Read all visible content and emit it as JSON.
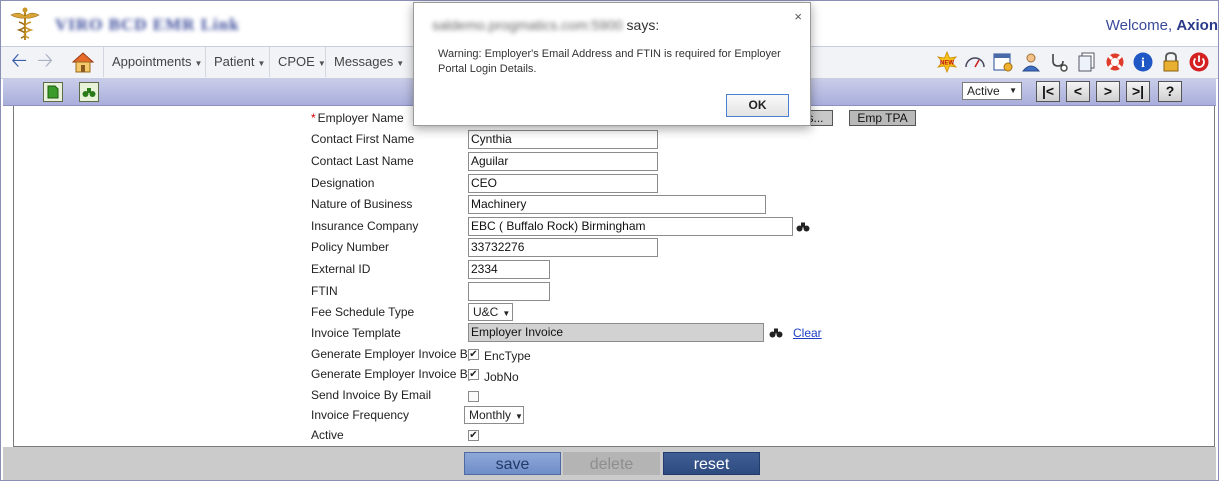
{
  "header": {
    "app_title": "VIRO BCD EMR Link",
    "welcome_text": "Welcome,",
    "user_name": "Axion"
  },
  "nav": {
    "menus": [
      {
        "label": "Appointments"
      },
      {
        "label": "Patient"
      },
      {
        "label": "CPOE"
      },
      {
        "label": "Messages"
      }
    ],
    "tool_icons": [
      "new-icon",
      "dashboard-icon",
      "calendar-icon",
      "user-icon",
      "stethoscope-icon",
      "documents-icon",
      "lifebuoy-icon",
      "info-icon",
      "lock-icon",
      "power-icon"
    ],
    "new_badge": "NEW"
  },
  "toolbar": {
    "status_value": "Active",
    "nav_first": "|<",
    "nav_prev": "<",
    "nav_next": ">",
    "nav_last": ">|",
    "help": "?",
    "emp_tpa_label": "Emp TPA",
    "browse_label": "s..."
  },
  "form": {
    "employer_name_label": "Employer Name",
    "contact_first_label": "Contact First Name",
    "contact_first_value": "Cynthia",
    "contact_last_label": "Contact Last Name",
    "contact_last_value": "Aguilar",
    "designation_label": "Designation",
    "designation_value": "CEO",
    "nature_label": "Nature of Business",
    "nature_value": "Machinery",
    "insurance_label": "Insurance Company",
    "insurance_value": "EBC ( Buffalo Rock) Birmingham",
    "policy_label": "Policy Number",
    "policy_value": "33732276",
    "external_label": "External ID",
    "external_value": "2334",
    "ftin_label": "FTIN",
    "ftin_value": "",
    "fee_label": "Fee Schedule Type",
    "fee_value": "U&C",
    "invoice_template_label": "Invoice Template",
    "invoice_template_value": "Employer Invoice",
    "clear_label": "Clear",
    "gen_invoice_label_1": "Generate Employer Invoice By",
    "gen_invoice_opt_1": "EncType",
    "gen_invoice_label_2": "Generate Employer Invoice By",
    "gen_invoice_opt_2": "JobNo",
    "send_email_label": "Send Invoice By Email",
    "frequency_label": "Invoice Frequency",
    "frequency_value": "Monthly",
    "active_label": "Active"
  },
  "footer": {
    "save_label": "save",
    "delete_label": "delete",
    "reset_label": "reset"
  },
  "dialog": {
    "origin": "saldemo.progmatics.com:5900",
    "says": "says:",
    "message": "Warning: Employer's Email Address and FTIN is required for Employer Portal Login Details.",
    "ok_label": "OK",
    "close_glyph": "×"
  }
}
